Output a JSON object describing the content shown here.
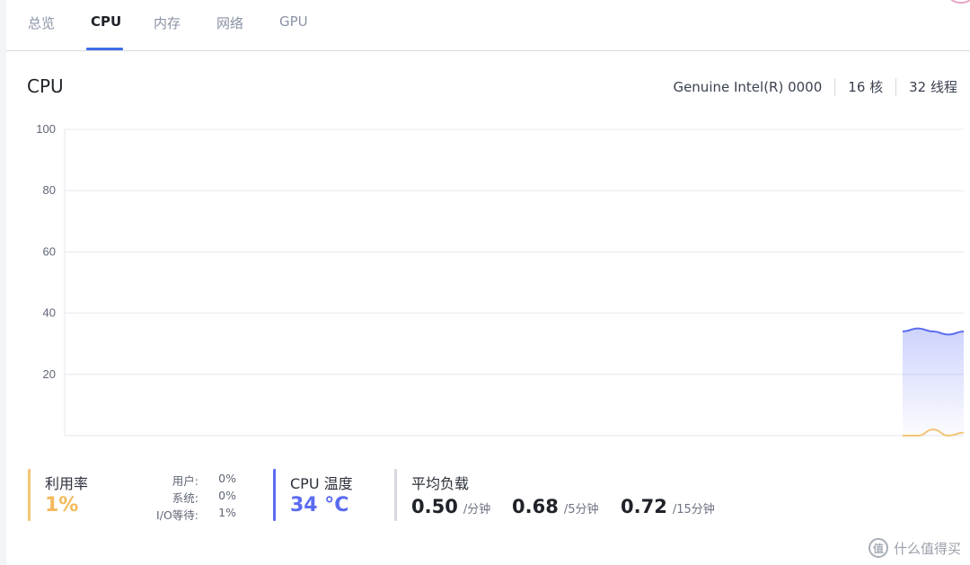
{
  "tabs": [
    {
      "label": "总览",
      "active": false
    },
    {
      "label": "CPU",
      "active": true
    },
    {
      "label": "内存",
      "active": false
    },
    {
      "label": "网络",
      "active": false
    },
    {
      "label": "GPU",
      "active": false
    }
  ],
  "header": {
    "title": "CPU",
    "model": "Genuine Intel(R) 0000",
    "cores": "16 核",
    "threads": "32 线程"
  },
  "chart_data": {
    "type": "area",
    "y_ticks": [
      "100",
      "80",
      "60",
      "40",
      "20"
    ],
    "ylim": [
      0,
      100
    ],
    "grid": true,
    "series": [
      {
        "values": [
          34,
          35,
          34,
          33,
          34
        ],
        "color": "#5b6cf2"
      },
      {
        "values": [
          0,
          0,
          2,
          0,
          1
        ],
        "color": "#f3c478"
      }
    ]
  },
  "stats": {
    "utilization": {
      "label": "利用率",
      "value": "1%",
      "user_label": "用户:",
      "user_value": "0%",
      "system_label": "系统:",
      "system_value": "0%",
      "io_label": "I/O等待:",
      "io_value": "1%"
    },
    "temperature": {
      "label": "CPU 温度",
      "value": "34 °C"
    },
    "load": {
      "label": "平均负载",
      "items": [
        {
          "value": "0.50",
          "unit": "/分钟"
        },
        {
          "value": "0.68",
          "unit": "/5分钟"
        },
        {
          "value": "0.72",
          "unit": "/15分钟"
        }
      ]
    }
  },
  "watermark": {
    "icon_text": "值",
    "text": "什么值得买"
  }
}
